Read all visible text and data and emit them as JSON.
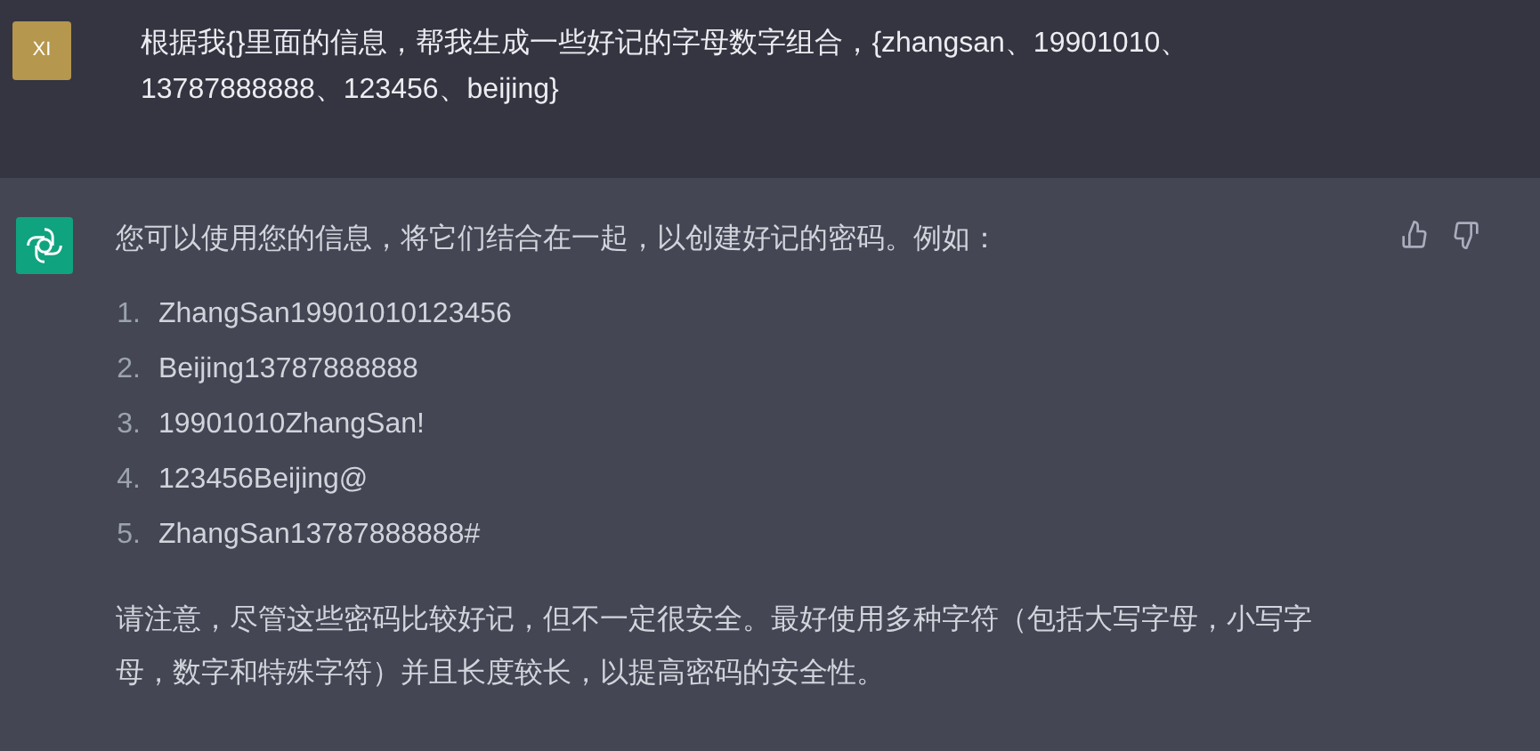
{
  "user_message": {
    "avatar": "XI",
    "text": "根据我{}里面的信息，帮我生成一些好记的字母数字组合，{zhangsan、19901010、13787888888、123456、beijing}"
  },
  "assistant_message": {
    "intro": "您可以使用您的信息，将它们结合在一起，以创建好记的密码。例如：",
    "items": [
      {
        "number": "1.",
        "text": "ZhangSan19901010123456"
      },
      {
        "number": "2.",
        "text": "Beijing13787888888"
      },
      {
        "number": "3.",
        "text": "19901010ZhangSan!"
      },
      {
        "number": "4.",
        "text": "123456Beijing@"
      },
      {
        "number": "5.",
        "text": "ZhangSan13787888888#"
      }
    ],
    "note": "请注意，尽管这些密码比较好记，但不一定很安全。最好使用多种字符（包括大写字母，小写字母，数字和特殊字符）并且长度较长，以提高密码的安全性。"
  }
}
